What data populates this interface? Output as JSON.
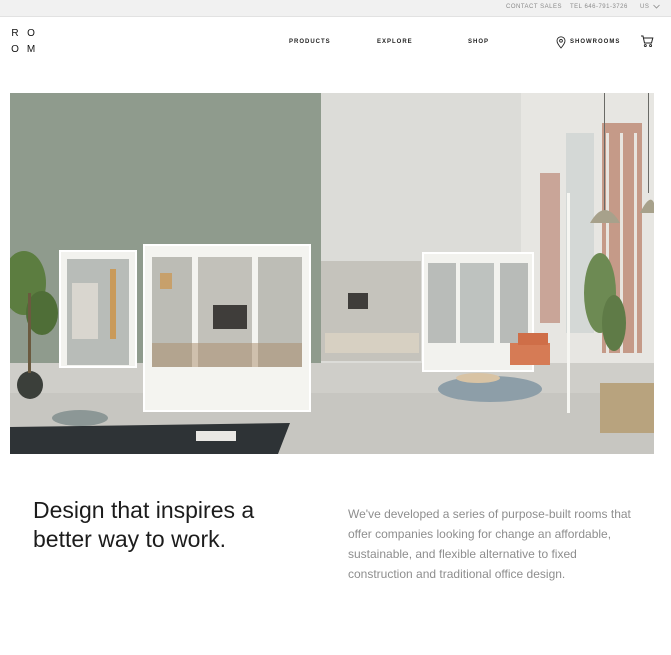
{
  "topbar": {
    "contact_sales": "CONTACT SALES",
    "tel": "TEL 646-791-3726",
    "locale": "US"
  },
  "logo": {
    "letters": [
      "R",
      "O",
      "O",
      "M"
    ]
  },
  "nav": {
    "products": "PRODUCTS",
    "explore": "EXPLORE",
    "shop": "SHOP",
    "showrooms": "SHOWROOMS"
  },
  "icons": {
    "location": "map-pin-icon",
    "cart": "shopping-cart-icon",
    "locale_dropdown": "chevron-down-icon"
  },
  "hero": {
    "headline": "Design that inspires a better way to work.",
    "body": "We've developed a series of purpose-built rooms that offer companies looking for change an affordable, sustainable, and flexible alternative to fixed construction and traditional office design."
  },
  "colors": {
    "topbar_bg": "#f1f1f1",
    "text_dark": "#1c1c1c",
    "text_muted": "#8e8e8e",
    "wall_green": "#8e9a8c"
  }
}
